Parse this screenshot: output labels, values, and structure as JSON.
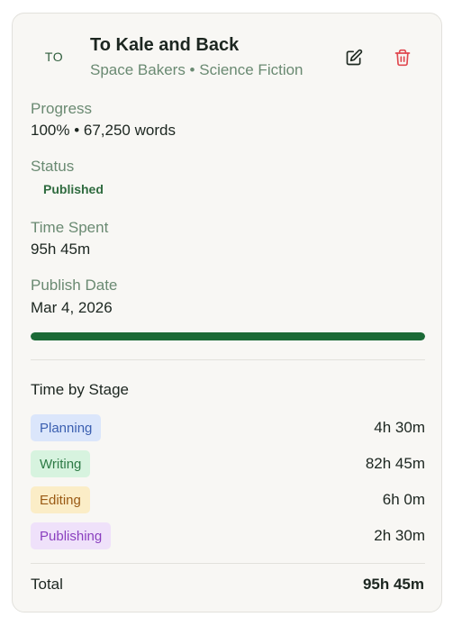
{
  "book": {
    "initials": "TO",
    "title": "To Kale and Back",
    "subtitle": "Space Bakers • Science Fiction"
  },
  "fields": {
    "progress_label": "Progress",
    "progress_value": "100% • 67,250 words",
    "progress_fraction": 1.0,
    "status_label": "Status",
    "status_value": "Published",
    "time_label": "Time Spent",
    "time_value": "95h 45m",
    "publish_label": "Publish Date",
    "publish_value": "Mar 4, 2026"
  },
  "stages": {
    "title": "Time by Stage",
    "items": [
      {
        "label": "Planning",
        "time": "4h 30m",
        "bg": "#dbe6fb",
        "fg": "#3b5fb0"
      },
      {
        "label": "Writing",
        "time": "82h 45m",
        "bg": "#d7f3df",
        "fg": "#2d7a45"
      },
      {
        "label": "Editing",
        "time": "6h 0m",
        "bg": "#fbedc7",
        "fg": "#9a5a14"
      },
      {
        "label": "Publishing",
        "time": "2h 30m",
        "bg": "#efe1fa",
        "fg": "#8a3fbf"
      }
    ],
    "total_label": "Total",
    "total_value": "95h 45m"
  },
  "colors": {
    "accent": "#1b6a36",
    "delete": "#e0484f"
  },
  "icons": {
    "edit": "edit-icon",
    "delete": "trash-icon"
  }
}
